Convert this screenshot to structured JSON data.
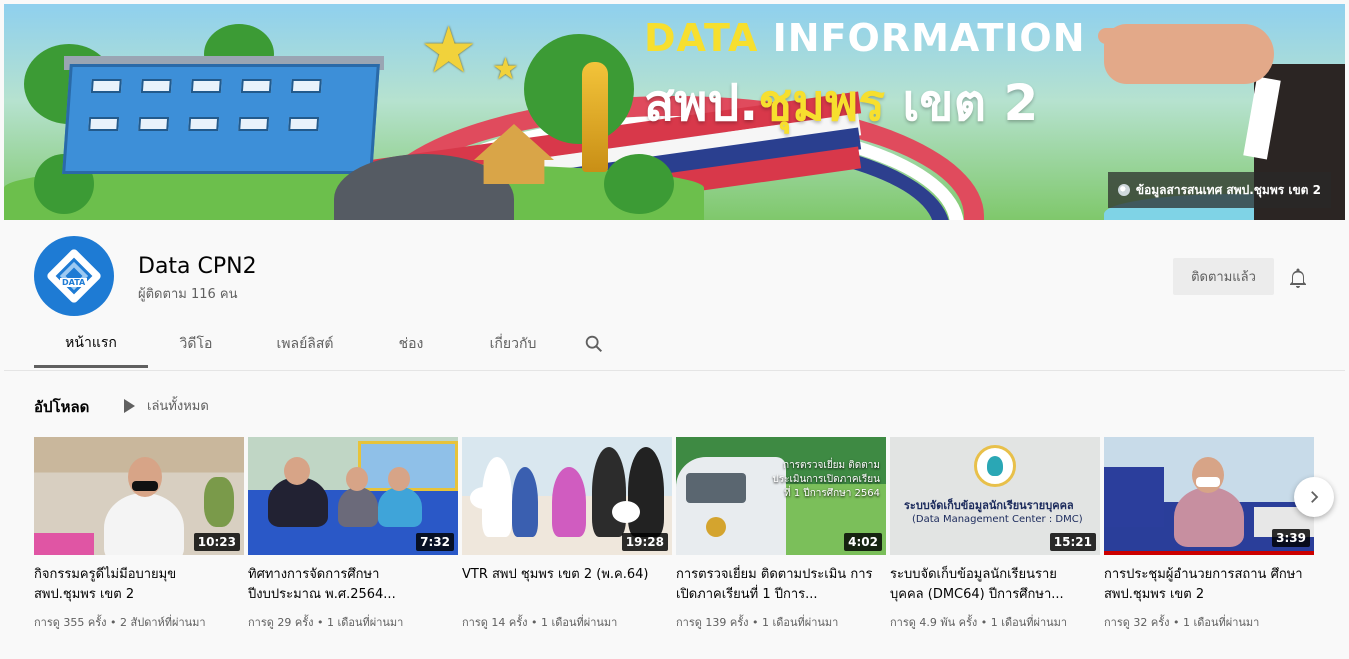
{
  "banner": {
    "title_line1_a": "DATA",
    "title_line1_b": " INFORMATION",
    "title_line2_a": "สพป.",
    "title_line2_b": "ชุมพร",
    "title_line2_c": " เขต 2",
    "link_label": "ข้อมูลสารสนเทศ สพป.ชุมพร เขต 2",
    "link_icon": "globe-icon",
    "colors": {
      "yellow": "#f7df2e",
      "red": "#d8384a",
      "blue": "#2a3f8f"
    }
  },
  "channel": {
    "name": "Data CPN2",
    "subscribers": "ผู้ติดตาม 116 คน",
    "avatar_text": "DATA",
    "subscribe_label": "ติดตามแล้ว",
    "bell_icon": "bell-icon"
  },
  "tabs": [
    {
      "label": "หน้าแรก",
      "active": true
    },
    {
      "label": "วิดีโอ",
      "active": false
    },
    {
      "label": "เพลย์ลิสต์",
      "active": false
    },
    {
      "label": "ช่อง",
      "active": false
    },
    {
      "label": "เกี่ยวกับ",
      "active": false
    }
  ],
  "shelf": {
    "title": "อัปโหลด",
    "play_all": "เล่นทั้งหมด",
    "next_icon": "chevron-right-icon"
  },
  "videos": [
    {
      "title": "กิจกรรมครูดีไม่มีอบายมุข สพป.ชุมพร เขต 2",
      "duration": "10:23",
      "meta": "การดู 355 ครั้ง • 2 สัปดาห์ที่ผ่านมา"
    },
    {
      "title": "ทิศทางการจัดการศึกษา ปีงบประมาณ พ.ศ.2564...",
      "duration": "7:32",
      "meta": "การดู 29 ครั้ง • 1 เดือนที่ผ่านมา"
    },
    {
      "title": "VTR สพป ชุมพร เขต 2 (พ.ค.64)",
      "duration": "19:28",
      "meta": "การดู 14 ครั้ง • 1 เดือนที่ผ่านมา"
    },
    {
      "title": "การตรวจเยี่ยม ติดตามประเมิน การเปิดภาคเรียนที่ 1 ปีการ...",
      "duration": "4:02",
      "meta": "การดู 139 ครั้ง • 1 เดือนที่ผ่านมา",
      "overlay": "การตรวจเยี่ยม ติดตาม ประเมินการเปิดภาคเรียนที่ 1 ปีการศึกษา 2564"
    },
    {
      "title": "ระบบจัดเก็บข้อมูลนักเรียนราย บุคคล (DMC64) ปีการศึกษา...",
      "duration": "15:21",
      "meta": "การดู 4.9 พัน ครั้ง • 1 เดือนที่ผ่านมา",
      "overlay_line1": "ระบบจัดเก็บข้อมูลนักเรียนรายบุคคล",
      "overlay_line2": "(Data Management Center : DMC)"
    },
    {
      "title": "การประชุมผู้อำนวยการสถาน ศึกษา สพป.ชุมพร เขต 2",
      "duration": "3:39",
      "meta": "การดู 32 ครั้ง • 1 เดือนที่ผ่านมา"
    }
  ]
}
